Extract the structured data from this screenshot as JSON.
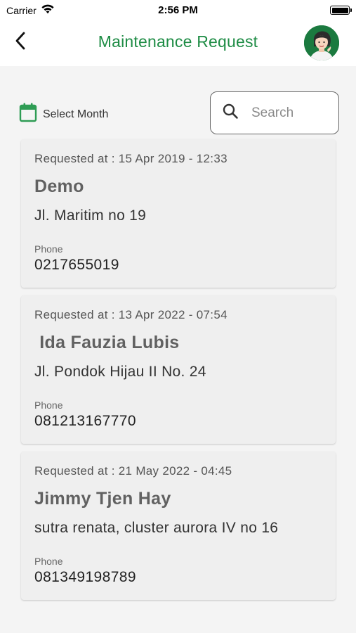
{
  "status_bar": {
    "carrier": "Carrier",
    "time": "2:56 PM"
  },
  "nav": {
    "title": "Maintenance Request"
  },
  "filter": {
    "month_label": "Select Month",
    "search_placeholder": "Search",
    "search_value": ""
  },
  "phone_label": "Phone",
  "requests": [
    {
      "requested_at": "Requested at : 15 Apr 2019 - 12:33",
      "name": "Demo",
      "address": "Jl. Maritim no 19",
      "phone_label": "Phone",
      "phone": "0217655019"
    },
    {
      "requested_at": "Requested at : 13 Apr 2022 - 07:54",
      "name": " Ida Fauzia Lubis",
      "address": "Jl. Pondok Hijau II No. 24",
      "phone_label": "Phone",
      "phone": "081213167770"
    },
    {
      "requested_at": "Requested at : 21 May 2022 - 04:45",
      "name": "Jimmy Tjen Hay",
      "address": "sutra renata, cluster aurora IV no 16",
      "phone_label": "Phone",
      "phone": "081349198789"
    }
  ],
  "colors": {
    "accent": "#1e8c45",
    "card_bg": "#efefef",
    "page_bg": "#f4f4f4"
  },
  "icons": {
    "back": "chevron-left-icon",
    "calendar": "calendar-icon",
    "search": "search-icon",
    "wifi": "wifi-icon",
    "battery": "battery-icon"
  }
}
